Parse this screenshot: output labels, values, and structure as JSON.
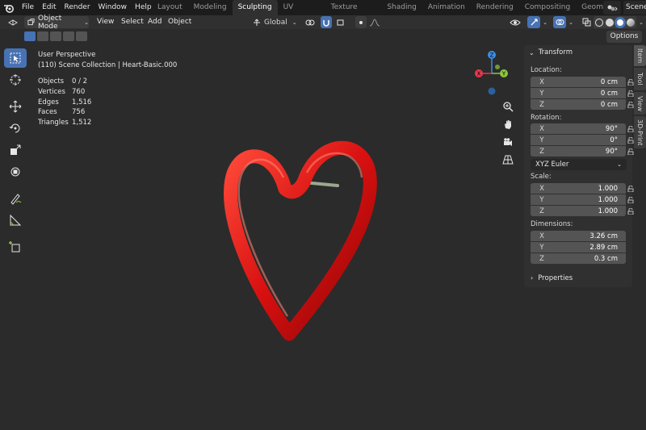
{
  "menu": {
    "items": [
      "File",
      "Edit",
      "Render",
      "Window",
      "Help"
    ]
  },
  "workspaces": {
    "tabs": [
      "Layout",
      "Modeling",
      "Sculpting",
      "UV Editing",
      "Texture Paint",
      "Shading",
      "Animation",
      "Rendering",
      "Compositing",
      "Geometry Nodes"
    ],
    "active": "Sculpting"
  },
  "scene": {
    "label": "Scene"
  },
  "header": {
    "mode": "Object Mode",
    "view": "View",
    "select": "Select",
    "add": "Add",
    "object": "Object",
    "orientation": "Global"
  },
  "options_label": "Options",
  "viewport": {
    "perspective": "User Perspective",
    "collection": "(110) Scene Collection | Heart-Basic.000",
    "stats": [
      {
        "label": "Objects",
        "value": "0 / 2"
      },
      {
        "label": "Vertices",
        "value": "760"
      },
      {
        "label": "Edges",
        "value": "1,516"
      },
      {
        "label": "Faces",
        "value": "756"
      },
      {
        "label": "Triangles",
        "value": "1,512"
      }
    ]
  },
  "gizmo": {
    "x": "X",
    "y": "Y",
    "z": "Z"
  },
  "transform": {
    "title": "Transform",
    "location_label": "Location:",
    "location": [
      {
        "axis": "X",
        "value": "0 cm"
      },
      {
        "axis": "Y",
        "value": "0 cm"
      },
      {
        "axis": "Z",
        "value": "0 cm"
      }
    ],
    "rotation_label": "Rotation:",
    "rotation": [
      {
        "axis": "X",
        "value": "90°"
      },
      {
        "axis": "Y",
        "value": "0°"
      },
      {
        "axis": "Z",
        "value": "90°"
      }
    ],
    "rotation_mode": "XYZ Euler",
    "scale_label": "Scale:",
    "scale": [
      {
        "axis": "X",
        "value": "1.000"
      },
      {
        "axis": "Y",
        "value": "1.000"
      },
      {
        "axis": "Z",
        "value": "1.000"
      }
    ],
    "dimensions_label": "Dimensions:",
    "dimensions": [
      {
        "axis": "X",
        "value": "3.26 cm"
      },
      {
        "axis": "Y",
        "value": "2.89 cm"
      },
      {
        "axis": "Z",
        "value": "0.3 cm"
      }
    ]
  },
  "properties_label": "Properties",
  "side_tabs": [
    "Item",
    "Tool",
    "View",
    "3D-Print"
  ],
  "colors": {
    "accent": "#4772b3",
    "heart": "#d81010",
    "axis_x": "#e8384f",
    "axis_y": "#8cc63e",
    "axis_z": "#3b8eea"
  }
}
